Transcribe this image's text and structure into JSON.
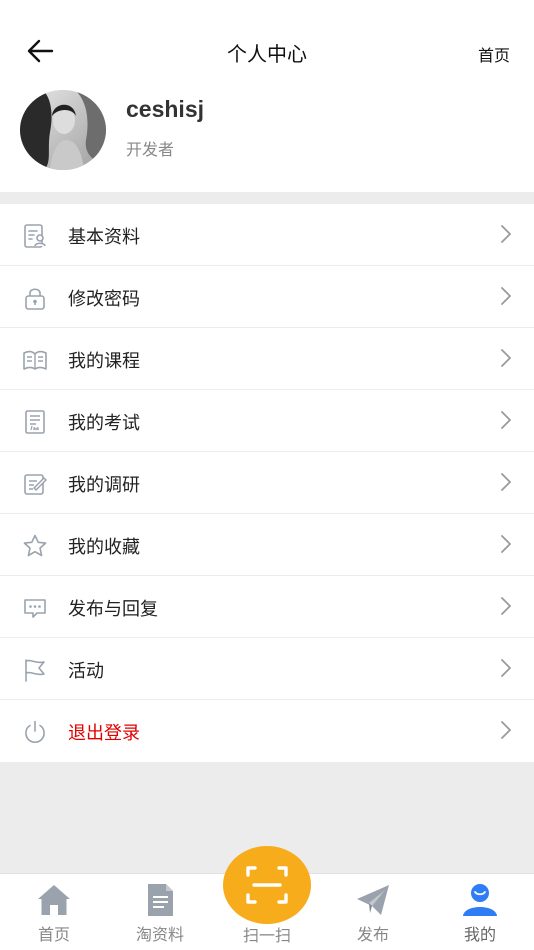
{
  "nav": {
    "title": "个人中心",
    "home_label": "首页"
  },
  "profile": {
    "username": "ceshisj",
    "role": "开发者"
  },
  "menu": [
    {
      "label": "基本资料",
      "icon": "profile-card-icon"
    },
    {
      "label": "修改密码",
      "icon": "lock-icon"
    },
    {
      "label": "我的课程",
      "icon": "book-icon"
    },
    {
      "label": "我的考试",
      "icon": "exam-paper-icon"
    },
    {
      "label": "我的调研",
      "icon": "edit-note-icon"
    },
    {
      "label": "我的收藏",
      "icon": "star-icon"
    },
    {
      "label": "发布与回复",
      "icon": "comment-icon"
    },
    {
      "label": "活动",
      "icon": "flag-icon"
    },
    {
      "label": "退出登录",
      "icon": "power-icon"
    }
  ],
  "tabs": [
    {
      "label": "首页",
      "icon": "home-icon"
    },
    {
      "label": "淘资料",
      "icon": "document-icon"
    },
    {
      "label": "扫一扫",
      "icon": "scan-icon"
    },
    {
      "label": "发布",
      "icon": "paper-plane-icon"
    },
    {
      "label": "我的",
      "icon": "user-icon"
    }
  ],
  "colors": {
    "accent": "#f7ac1b",
    "danger": "#e10000",
    "active_tab": "#2f7df6",
    "inactive_icon": "#9aa3ad"
  }
}
